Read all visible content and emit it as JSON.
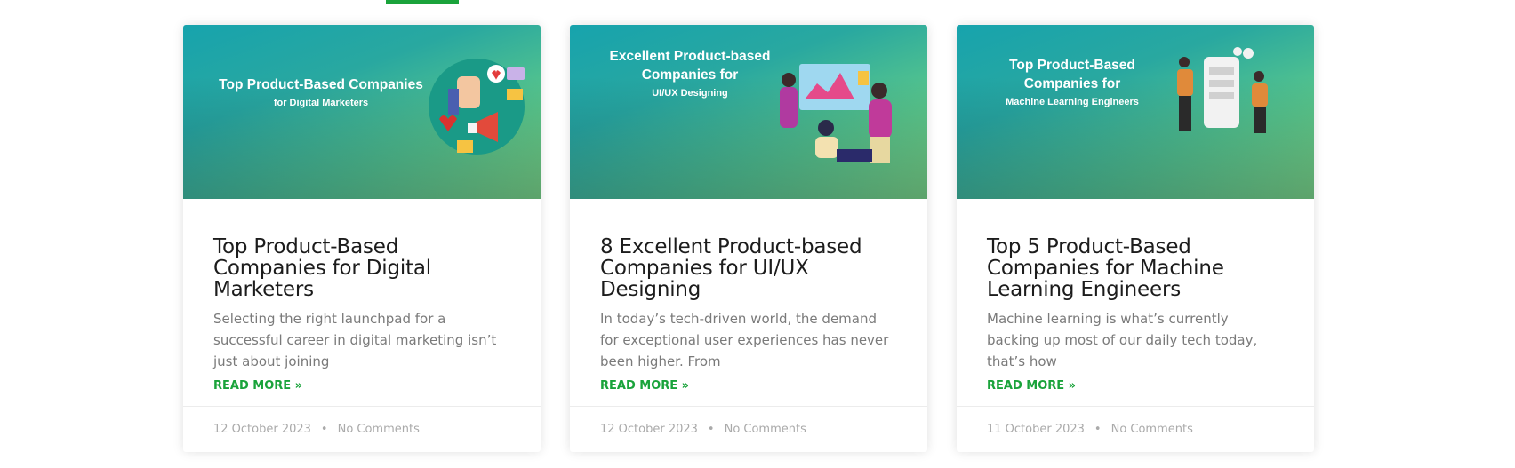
{
  "posts": [
    {
      "thumb": {
        "line1": "Top Product-Based Companies",
        "line2": "",
        "line3": "for Digital Marketers"
      },
      "title": "Top Product-Based Companies for Digital Marketers",
      "excerpt": "Selecting the right launchpad for a successful career in digital marketing isn’t just about joining",
      "read_more": "READ MORE »",
      "date": "12 October 2023",
      "comments": "No Comments"
    },
    {
      "thumb": {
        "line1": "Excellent Product-based",
        "line2": "Companies for",
        "line3": "UI/UX Designing"
      },
      "title": "8 Excellent Product-based Companies for UI/UX Designing",
      "excerpt": "In today’s tech-driven world, the demand for exceptional user experiences has never been higher. From",
      "read_more": "READ MORE »",
      "date": "12 October 2023",
      "comments": "No Comments"
    },
    {
      "thumb": {
        "line1": "Top Product-Based",
        "line2": "Companies for",
        "line3": "Machine Learning Engineers"
      },
      "title": "Top 5 Product-Based Companies for Machine Learning Engineers",
      "excerpt": "Machine learning is what’s currently backing up most of our daily tech today, that’s how",
      "read_more": "READ MORE »",
      "date": "11 October 2023",
      "comments": "No Comments"
    }
  ],
  "meta_separator": "•",
  "colors": {
    "accent": "#1aa33b"
  }
}
